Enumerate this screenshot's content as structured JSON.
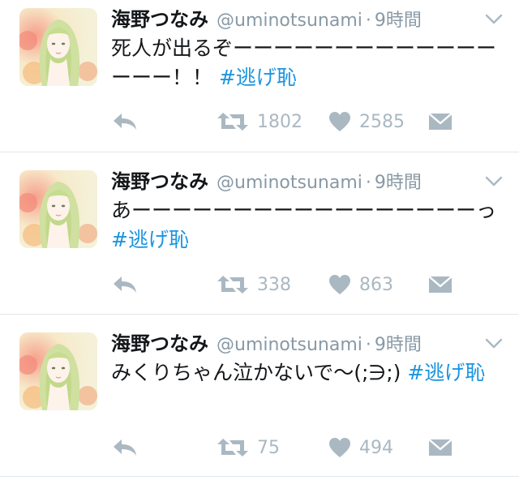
{
  "tweets": [
    {
      "name": "海野つなみ",
      "handle": "@uminotsunami",
      "separator": "·",
      "time": "9時間",
      "text": "死人が出るぞーーーーーーーーーーーーーーーー！！",
      "hashtag": "#逃げ恥",
      "retweets": "1802",
      "likes": "2585"
    },
    {
      "name": "海野つなみ",
      "handle": "@uminotsunami",
      "separator": "·",
      "time": "9時間",
      "text": "あーーーーーーーーーーーーーーーーーっ",
      "hashtag": "#逃げ恥",
      "retweets": "338",
      "likes": "863"
    },
    {
      "name": "海野つなみ",
      "handle": "@uminotsunami",
      "separator": "·",
      "time": "9時間",
      "text": "みくりちゃん泣かないで〜(;∋;)",
      "hashtag": "#逃げ恥",
      "retweets": "75",
      "likes": "494"
    }
  ],
  "colors": {
    "name": "#14171a",
    "meta": "#8899a6",
    "hashtag": "#1b95e0",
    "action_icon": "#aab8c2",
    "divider": "#e1e8ed"
  },
  "icons": {
    "reply": "reply-icon",
    "retweet": "retweet-icon",
    "like": "heart-icon",
    "dm": "envelope-icon",
    "menu": "chevron-down-icon"
  }
}
